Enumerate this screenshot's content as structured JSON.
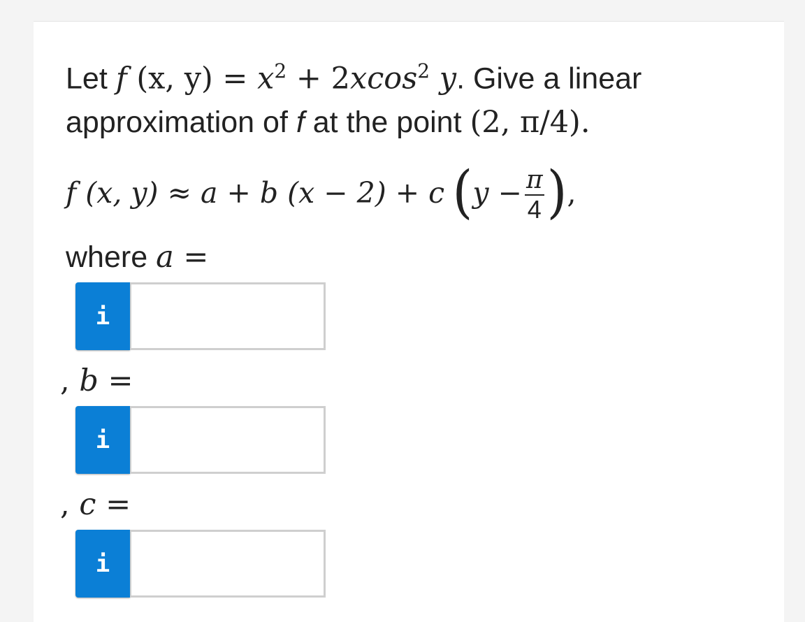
{
  "question": {
    "prefix": "Let ",
    "fn": "f",
    "args": " (x, y)",
    "eq": " = ",
    "x": "x",
    "two": "2",
    "plus": " + 2",
    "xcos": "xcos",
    "two2": "2",
    "y": " y",
    "suffix": ". Give a linear approximation of ",
    "f2": "f",
    "at": " at the point ",
    "point": "(2, π/4)."
  },
  "formula": {
    "lhs": "f (x, y) ≈ a + b (x − 2) + c",
    "paren_open": "(",
    "y_minus": "y −",
    "frac_num": "π",
    "frac_den": "4",
    "paren_close": ")",
    "comma": ","
  },
  "labels": {
    "a_word": "where ",
    "a_var": "a",
    "a_eq": " =",
    "b_comma": ", ",
    "b_var": "b",
    "b_eq": " =",
    "c_comma": ", ",
    "c_var": "c",
    "c_eq": " ="
  },
  "inputs": {
    "info_glyph": "i",
    "a_value": "",
    "b_value": "",
    "c_value": ""
  },
  "colors": {
    "info_button": "#0b7fd6",
    "input_border": "#cfcfcf"
  }
}
